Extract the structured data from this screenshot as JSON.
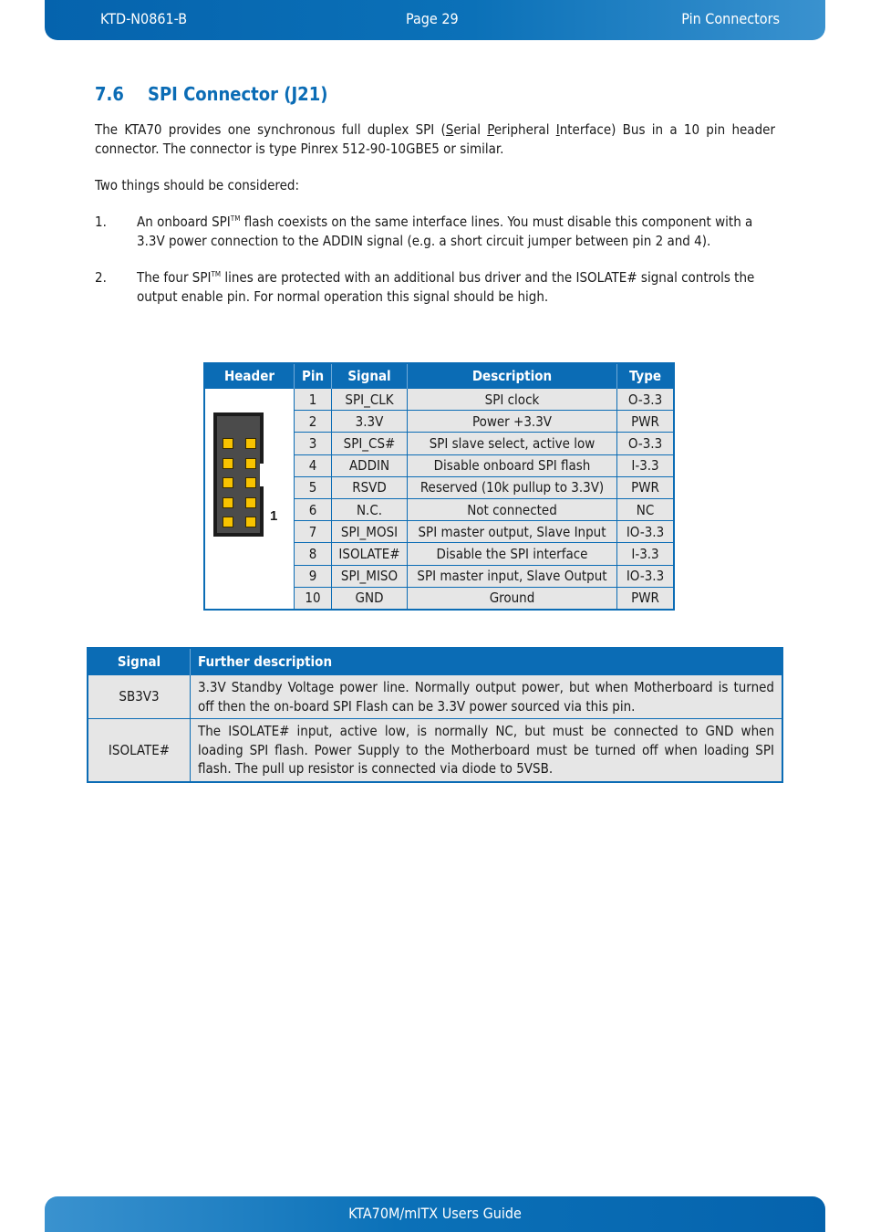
{
  "page_header": {
    "doc_id": "KTD-N0861-B",
    "page": "Page 29",
    "chapter": "Pin Connectors"
  },
  "section": {
    "number": "7.6",
    "title": "SPI Connector (J21)"
  },
  "intro": {
    "p1_a": "The KTA70 provides one synchronous full duplex SPI (",
    "p1_S": "S",
    "p1_b": "erial ",
    "p1_P": "P",
    "p1_c": "eripheral ",
    "p1_I": "I",
    "p1_d": "nterface) Bus in a 10 pin header connector. The connector is type Pinrex 512-90-10GBE5 or similar.",
    "p2": "Two things should be considered:"
  },
  "list": [
    {
      "number": "1.",
      "before_tm": "An onboard SPI",
      "tm": "TM",
      "after_tm": " flash coexists on the same interface lines. You must disable this component with a 3.3V power connection to the ADDIN signal (e.g. a short circuit jumper between pin 2 and 4)."
    },
    {
      "number": "2.",
      "before_tm": "The four SPI",
      "tm": "TM",
      "after_tm": " lines are protected with an additional bus driver and the ISOLATE# signal controls the output enable pin. For normal operation this signal should be high."
    }
  ],
  "pin_table": {
    "columns": [
      "Header",
      "Pin",
      "Signal",
      "Description",
      "Type"
    ],
    "pin1_label": "1",
    "rows": [
      {
        "pin": "1",
        "signal": "SPI_CLK",
        "description": "SPI clock",
        "type": "O-3.3"
      },
      {
        "pin": "2",
        "signal": "3.3V",
        "description": "Power +3.3V",
        "type": "PWR"
      },
      {
        "pin": "3",
        "signal": "SPI_CS#",
        "description": "SPI slave select, active low",
        "type": "O-3.3"
      },
      {
        "pin": "4",
        "signal": "ADDIN",
        "description": "Disable onboard SPI flash",
        "type": "I-3.3"
      },
      {
        "pin": "5",
        "signal": "RSVD",
        "description": "Reserved (10k pullup to 3.3V)",
        "type": "PWR"
      },
      {
        "pin": "6",
        "signal": "N.C.",
        "description": "Not connected",
        "type": "NC"
      },
      {
        "pin": "7",
        "signal": "SPI_MOSI",
        "description": "SPI master output, Slave Input",
        "type": "IO-3.3"
      },
      {
        "pin": "8",
        "signal": "ISOLATE#",
        "description": "Disable the SPI interface",
        "type": "I-3.3"
      },
      {
        "pin": "9",
        "signal": "SPI_MISO",
        "description": "SPI master input, Slave Output",
        "type": "IO-3.3"
      },
      {
        "pin": "10",
        "signal": "GND",
        "description": "Ground",
        "type": "PWR"
      }
    ]
  },
  "desc_table": {
    "columns": [
      "Signal",
      "Further description"
    ],
    "rows": [
      {
        "signal": "SB3V3",
        "description": "3.3V Standby Voltage power line. Normally output power, but when Motherboard is turned off then the on-board SPI Flash can be 3.3V power sourced via this pin."
      },
      {
        "signal": "ISOLATE#",
        "description": "The ISOLATE# input, active low, is normally NC, but must be connected to GND when loading SPI flash.  Power Supply to the Motherboard must be turned off when loading SPI flash. The pull up resistor is connected via diode to 5VSB."
      }
    ]
  },
  "page_footer": {
    "title": "KTA70M/mITX Users Guide"
  },
  "colors": {
    "brand_blue": "#0b6cb5",
    "cell_gray": "#e6e6e6",
    "pin_yellow": "#f8c300"
  }
}
